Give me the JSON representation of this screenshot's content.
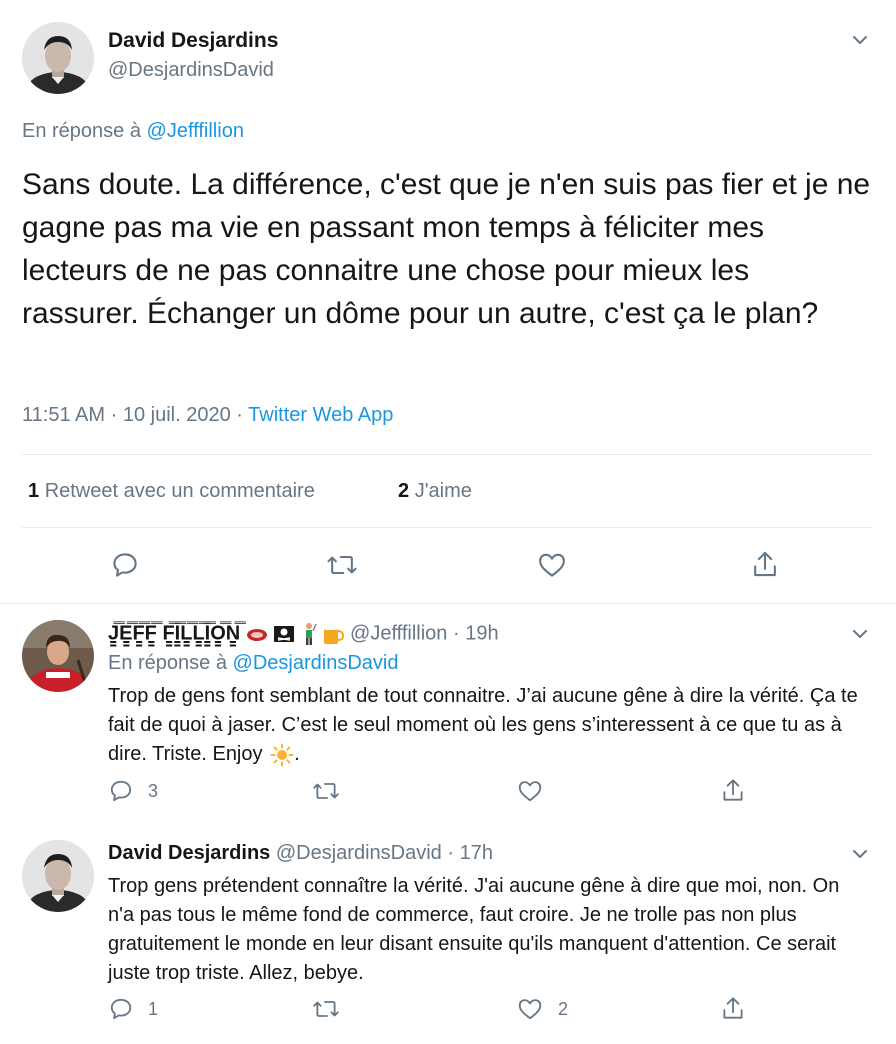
{
  "main_tweet": {
    "author_name": "David Desjardins",
    "author_handle": "@DesjardinsDavid",
    "reply_prefix": "En réponse à",
    "reply_mention": "@Jefffillion",
    "text": "Sans doute. La différence, c'est que je n'en suis pas fier et je ne gagne pas ma vie en passant mon temps à féliciter mes lecteurs de ne pas connaitre une chose pour mieux les rassurer. Échanger un dôme pour un autre, c'est ça le plan?",
    "time": "11:51 AM",
    "date": "10 juil. 2020",
    "separator": "·",
    "source": "Twitter Web App",
    "retweets_count": "1",
    "retweets_label": "Retweet avec un commentaire",
    "likes_count": "2",
    "likes_label": "J'aime"
  },
  "replies": [
    {
      "author_name": "J̳̿E̳̿F̳̿F̳̿ F̳̿I̳̿L̳̿L̳̿I̳̿O̳̿N̳̿",
      "author_emojis": [
        "meat-icon",
        "skull-flag-icon",
        "golfer-icon",
        "beer-icon"
      ],
      "author_handle": "@Jefffillion",
      "separator": "·",
      "age": "19h",
      "reply_prefix": "En réponse à",
      "reply_mention": "@DesjardinsDavid",
      "text": "Trop de gens font semblant de tout connaitre. J’ai aucune gêne à dire la vérité. Ça te fait de quoi à jaser. C’est le seul moment où les gens s’interessent à ce que tu as à dire. Triste. Enjoy",
      "text_suffix": ".",
      "trailing_emoji": "sun-icon",
      "reply_count": "3",
      "retweet_count": "",
      "like_count": ""
    },
    {
      "author_name": "David Desjardins",
      "author_handle": "@DesjardinsDavid",
      "separator": "·",
      "age": "17h",
      "text": "Trop gens prétendent connaître la vérité. J'ai aucune gêne à dire que moi, non. On n'a pas tous le même fond de commerce, faut croire. Je ne trolle pas non plus gratuitement le monde en leur disant ensuite qu'ils manquent d'attention. Ce serait juste trop triste. Allez, bebye.",
      "reply_count": "1",
      "retweet_count": "",
      "like_count": "2"
    }
  ],
  "colors": {
    "text": "#14171a",
    "secondary": "#657786",
    "link": "#1b95e0",
    "divider": "#e6ecf0"
  }
}
